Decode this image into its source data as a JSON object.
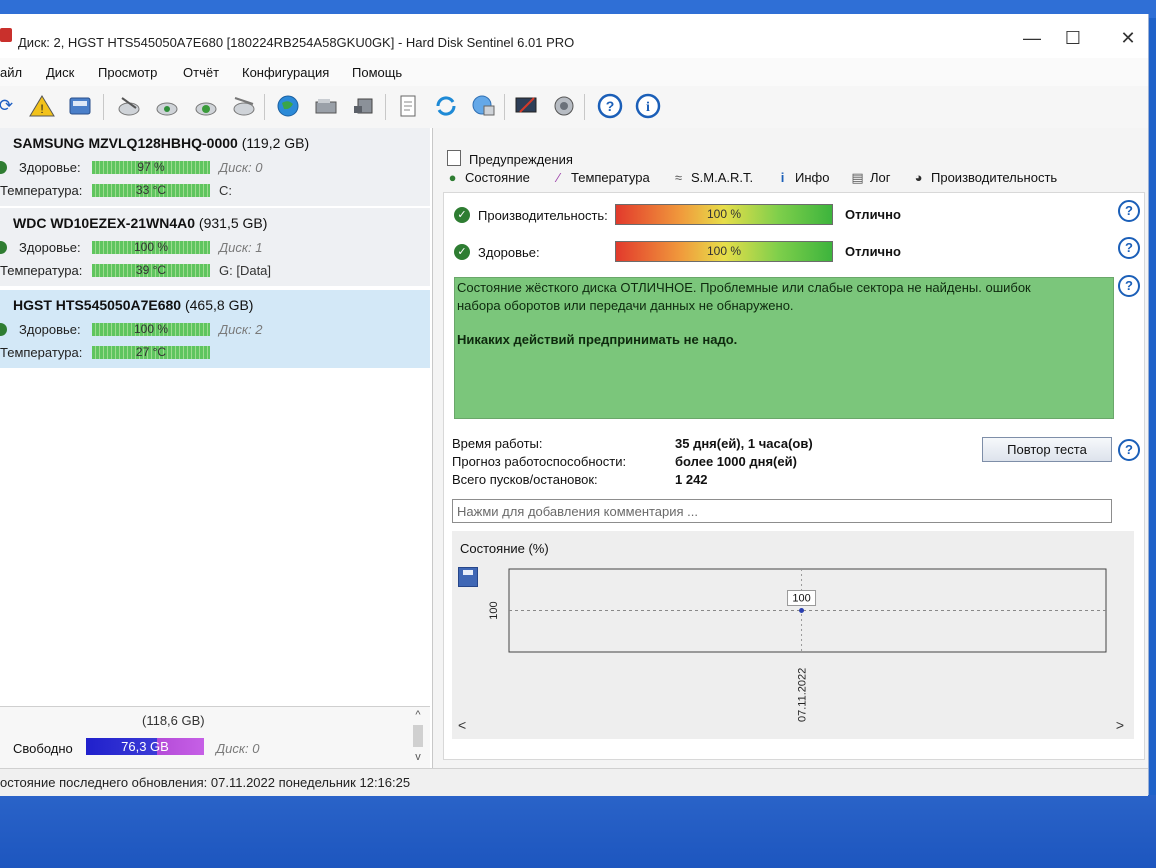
{
  "window": {
    "title": "Диск: 2, HGST HTS545050A7E680 [180224RB254A58GKU0GK]  -  Hard Disk Sentinel 6.01 PRO",
    "minimize": "—",
    "maximize": "☐",
    "close": "✕"
  },
  "menu": [
    "айл",
    "Диск",
    "Просмотр",
    "Отчёт",
    "Конфигурация",
    "Помощь"
  ],
  "toolbar": {
    "icons": [
      "refresh-icon",
      "warning-icon",
      "disk-icon",
      "disk-test-1-icon",
      "disk-test-2-icon",
      "disk-test-3-icon",
      "disk-test-4-icon",
      "globe-icon",
      "drive-icon",
      "drive-2-icon",
      "report-icon",
      "sync-icon",
      "network-icon",
      "config-icon",
      "sound-icon",
      "help-icon",
      "info-icon"
    ]
  },
  "disks": [
    {
      "name": "SAMSUNG MZVLQ128HBHQ-0000",
      "size": "(119,2 GB)",
      "health_label": "Здоровье:",
      "health": "97 %",
      "health_value": 97,
      "disk": "Диск: 0",
      "temp_label": "Температура:",
      "temp": "33 °C",
      "volume": "C:"
    },
    {
      "name": "WDC WD10EZEX-21WN4A0",
      "size": "(931,5 GB)",
      "health_label": "Здоровье:",
      "health": "100 %",
      "health_value": 100,
      "disk": "Диск: 1",
      "temp_label": "Температура:",
      "temp": "39 °C",
      "volume": "G: [Data]"
    },
    {
      "name": "HGST HTS545050A7E680",
      "size": "(465,8 GB)",
      "health_label": "Здоровье:",
      "health": "100 %",
      "health_value": 100,
      "disk": "Диск: 2",
      "temp_label": "Температура:",
      "temp": "27 °C",
      "volume": ""
    }
  ],
  "volume_panel": {
    "size": "(118,6 GB)",
    "free_label": "Свободно",
    "free_value": "76,3 GB",
    "free_fraction": 0.64,
    "disk": "Диск: 0",
    "scroll_up": "^",
    "scroll_down": "v"
  },
  "statusbar": "остояние последнего обновления: 07.11.2022 понедельник 12:16:25",
  "tabs": {
    "warnings": "Предупреждения",
    "items": [
      "Состояние",
      "Температура",
      "S.M.A.R.T.",
      "Инфо",
      "Лог",
      "Производительность"
    ]
  },
  "metrics": [
    {
      "label": "Производительность:",
      "bar": "100 %",
      "value": 100,
      "status": "Отлично"
    },
    {
      "label": "Здоровье:",
      "bar": "100 %",
      "value": 100,
      "status": "Отлично"
    }
  ],
  "help_symbol": "?",
  "status_message": {
    "line1": "Состояние жёсткого диска ОТЛИЧНОЕ. Проблемные или слабые сектора не найдены. ошибок",
    "line2": "набора оборотов или передачи данных не обнаружено.",
    "action": "Никаких действий предпринимать не надо."
  },
  "info": [
    {
      "label": "Время работы:",
      "value": "35 дня(ей), 1 часа(ов)"
    },
    {
      "label": "Прогноз работоспособности:",
      "value": "более 1000 дня(ей)"
    },
    {
      "label": "Всего пусков/остановок:",
      "value": "1 242"
    }
  ],
  "repeat_button": "Повтор теста",
  "comment": {
    "placeholder": "Нажми для добавления комментария ..."
  },
  "chart_data": {
    "type": "line",
    "title": "Состояние (%)",
    "x": [
      "07.11.2022"
    ],
    "series": [
      {
        "values": [
          100
        ]
      }
    ],
    "yticks": [
      "100"
    ],
    "data_labels": [
      "100"
    ],
    "grid": true
  },
  "chart_scroll": {
    "left": "<",
    "right": ">"
  },
  "colors": {
    "good": "#7bc67b",
    "accent": "#1b5fb8",
    "selected": "#d3e8f7"
  }
}
